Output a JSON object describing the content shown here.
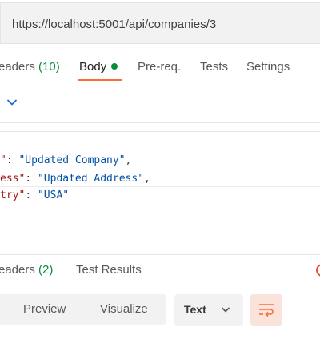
{
  "url": {
    "value": "https://localhost:5001/api/companies/3"
  },
  "request_tabs": {
    "headers": {
      "label": "eaders",
      "count": "(10)"
    },
    "body": {
      "label": "Body"
    },
    "prereq": {
      "label": "Pre-req."
    },
    "tests": {
      "label": "Tests"
    },
    "settings": {
      "label": "Settings"
    }
  },
  "body_code": {
    "line1": {
      "key": "\"",
      "colon": ": ",
      "value": "\"Updated Company\"",
      "trail": ","
    },
    "line2": {
      "key": "ess\"",
      "colon": ": ",
      "value": "\"Updated Address\"",
      "trail": ","
    },
    "line3": {
      "key": "try\"",
      "colon": ": ",
      "value": "\"USA\"",
      "trail": ""
    }
  },
  "response_tabs": {
    "headers": {
      "label": "eaders",
      "count": "(2)"
    },
    "test_results": {
      "label": "Test Results"
    }
  },
  "response_toolbar": {
    "preview": "Preview",
    "visualize": "Visualize",
    "format_select": "Text"
  },
  "icons": {
    "body_dot": "status-dot-icon",
    "chevron": "chevron-down-icon",
    "wrap": "wrap-lines-icon",
    "warning": "warning-circle-icon"
  },
  "colors": {
    "accent": "#ff6c37",
    "count_green": "#0b8a3e",
    "json_key": "#a31515",
    "json_string": "#0451a5"
  }
}
